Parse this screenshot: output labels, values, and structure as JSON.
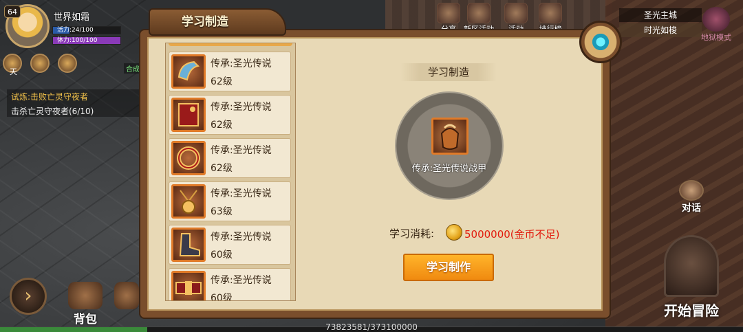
{
  "player": {
    "level": "64",
    "name": "世界如霜",
    "vitality": "活力:24/100",
    "vitality_fraction": 0.24,
    "stamina": "体力:100/100",
    "stamina_fraction": 1.0,
    "hud_tag": "天",
    "green_tag": "合成"
  },
  "quest": {
    "title": "试炼:击败亡灵守夜者",
    "progress": "击杀亡灵守夜者(6/10)"
  },
  "top_menu": [
    {
      "label": "分享"
    },
    {
      "label": "新区活动"
    },
    {
      "label": "活动"
    },
    {
      "label": "排行榜"
    }
  ],
  "location": {
    "city": "圣光主城",
    "sub": "时光如梭"
  },
  "hell_mode": "地狱模式",
  "talk": "对话",
  "adventure": "开始冒险",
  "bag": "背包",
  "exp": {
    "text": "73823581/373100000",
    "fraction": 0.198
  },
  "dialog": {
    "title": "学习制造",
    "detail_title": "学习制造",
    "selected_item": "传承:圣光传说战甲",
    "cost_label": "学习消耗:",
    "cost_value": "5000000(金币不足)",
    "learn_button": "学习制作"
  },
  "recipes": [
    {
      "name": "传承:圣光传说",
      "level": "62级",
      "icon": "helmet-icon"
    },
    {
      "name": "传承:圣光传说",
      "level": "62级",
      "icon": "spellbook-icon"
    },
    {
      "name": "传承:圣光传说",
      "level": "62级",
      "icon": "ring-icon"
    },
    {
      "name": "传承:圣光传说",
      "level": "63级",
      "icon": "necklace-icon"
    },
    {
      "name": "传承:圣光传说",
      "level": "60级",
      "icon": "boots-icon"
    },
    {
      "name": "传承:圣光传说",
      "level": "60级",
      "icon": "belt-icon"
    }
  ],
  "colors": {
    "accent_orange": "#f08a10",
    "insufficient_red": "#e21a0c",
    "frame_brown": "#7a4e2c",
    "parchment": "#e8d9b6"
  }
}
